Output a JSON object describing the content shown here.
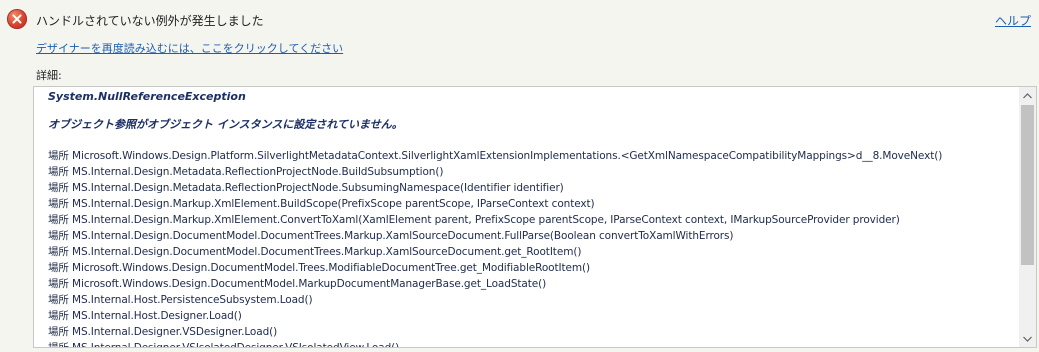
{
  "header": {
    "title": "ハンドルされていない例外が発生しました",
    "help_label": "ヘルプ"
  },
  "reload_link": "デザイナーを再度読み込むには、ここをクリックしてください",
  "details": {
    "label": "詳細:",
    "exception_type": "System.NullReferenceException",
    "exception_message": "オブジェクト参照がオブジェクト インスタンスに設定されていません。",
    "stack": [
      "場所 Microsoft.Windows.Design.Platform.SilverlightMetadataContext.SilverlightXamlExtensionImplementations.<GetXmlNamespaceCompatibilityMappings>d__8.MoveNext()",
      "場所 MS.Internal.Design.Metadata.ReflectionProjectNode.BuildSubsumption()",
      "場所 MS.Internal.Design.Metadata.ReflectionProjectNode.SubsumingNamespace(Identifier identifier)",
      "場所 MS.Internal.Design.Markup.XmlElement.BuildScope(PrefixScope parentScope, IParseContext context)",
      "場所 MS.Internal.Design.Markup.XmlElement.ConvertToXaml(XamlElement parent, PrefixScope parentScope, IParseContext context, IMarkupSourceProvider provider)",
      "場所 MS.Internal.Design.DocumentModel.DocumentTrees.Markup.XamlSourceDocument.FullParse(Boolean convertToXamlWithErrors)",
      "場所 MS.Internal.Design.DocumentModel.DocumentTrees.Markup.XamlSourceDocument.get_RootItem()",
      "場所 Microsoft.Windows.Design.DocumentModel.Trees.ModifiableDocumentTree.get_ModifiableRootItem()",
      "場所 Microsoft.Windows.Design.DocumentModel.MarkupDocumentManagerBase.get_LoadState()",
      "場所 MS.Internal.Host.PersistenceSubsystem.Load()",
      "場所 MS.Internal.Host.Designer.Load()",
      "場所 MS.Internal.Designer.VSDesigner.Load()",
      "場所 MS.Internal.Designer.VSIsolatedDesigner.VSIsolatedView.Load()"
    ]
  },
  "icons": {
    "error": "error-icon",
    "scroll_up": "chevron-up-icon",
    "scroll_down": "chevron-down-icon"
  }
}
